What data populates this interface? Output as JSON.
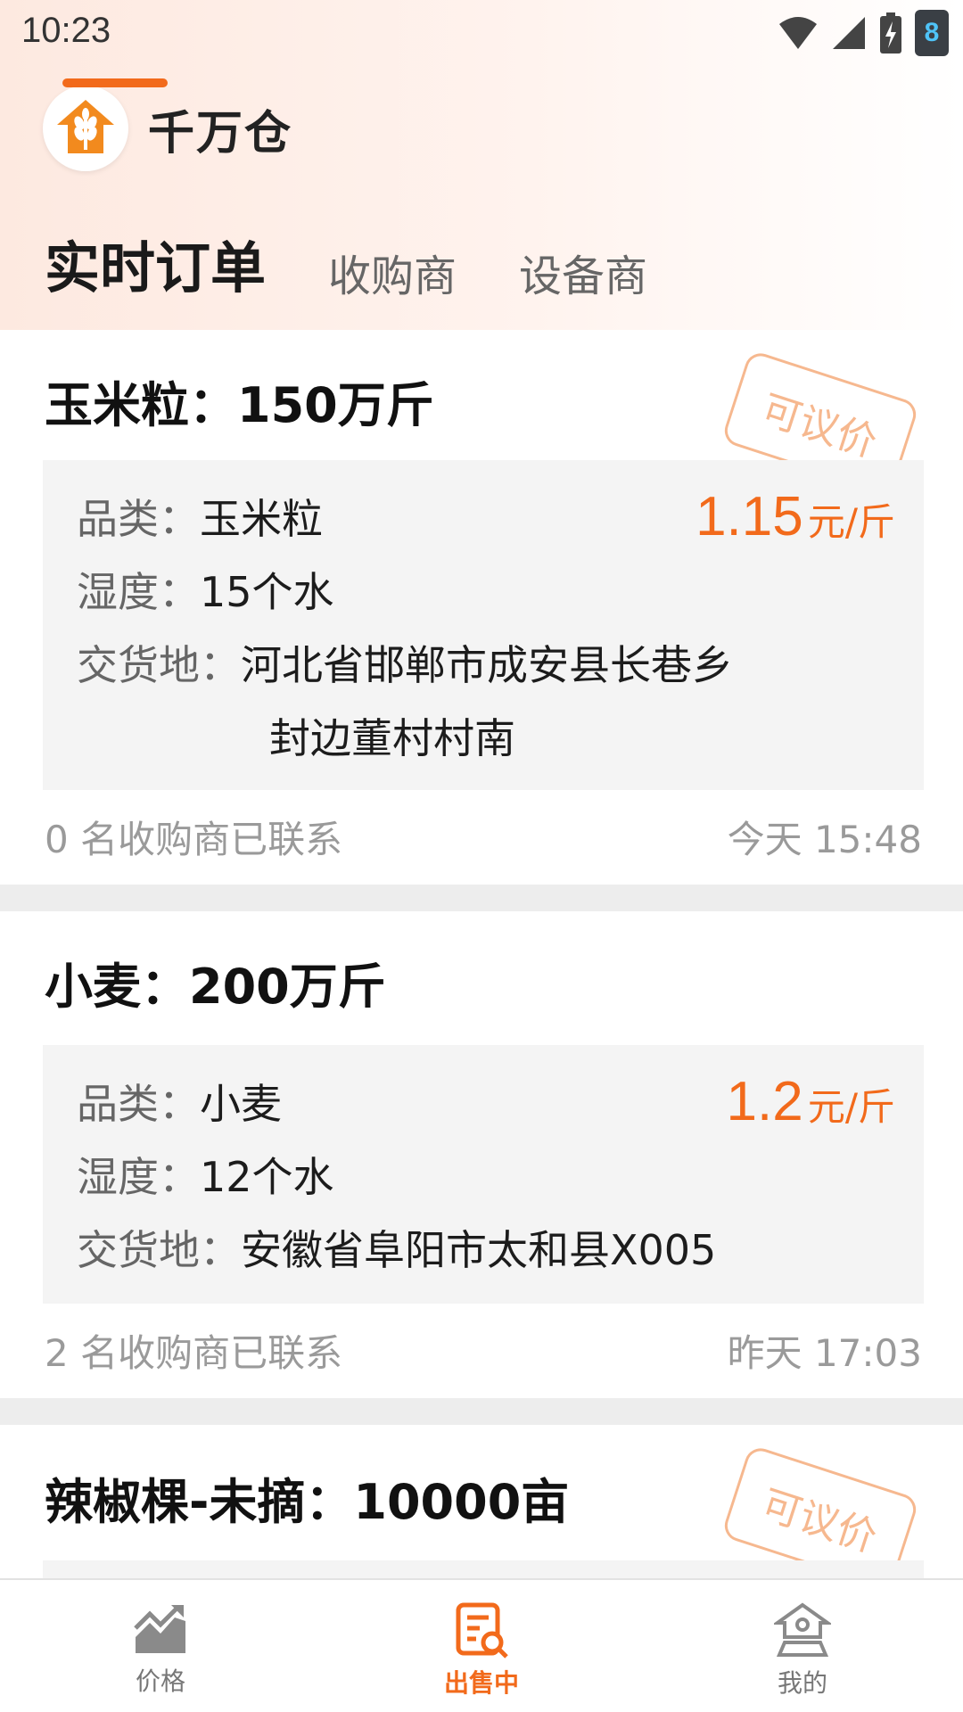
{
  "status_bar": {
    "time": "10:23",
    "battery_level": "8"
  },
  "brand": {
    "name": "千万仓"
  },
  "tabs": [
    {
      "label": "实时订单",
      "active": true
    },
    {
      "label": "收购商",
      "active": false
    },
    {
      "label": "设备商",
      "active": false
    }
  ],
  "orders": [
    {
      "title": "玉米粒：150万斤",
      "stamp": "可议价",
      "category_label": "品类：",
      "category": "玉米粒",
      "moisture_label": "湿度：",
      "moisture": "15个水",
      "location_label": "交货地：",
      "location_line1": "河北省邯郸市成安县长巷乡",
      "location_line2": "封边董村村南",
      "price": "1.15",
      "price_unit": "元/斤",
      "contacts": "0 名收购商已联系",
      "time": "今天 15:48"
    },
    {
      "title": "小麦：200万斤",
      "category_label": "品类：",
      "category": "小麦",
      "moisture_label": "湿度：",
      "moisture": "12个水",
      "location_label": "交货地：",
      "location_line1": "安徽省阜阳市太和县X005",
      "price": "1.2",
      "price_unit": "元/斤",
      "contacts": "2 名收购商已联系",
      "time": "昨天 17:03"
    },
    {
      "title": "辣椒棵-未摘：10000亩",
      "stamp": "可议价"
    }
  ],
  "bottom_nav": [
    {
      "label": "价格",
      "icon": "chart-trend-icon",
      "active": false
    },
    {
      "label": "出售中",
      "icon": "order-search-icon",
      "active": true
    },
    {
      "label": "我的",
      "icon": "warehouse-user-icon",
      "active": false
    }
  ],
  "colors": {
    "accent": "#f26a1b",
    "stamp": "#f6b88f",
    "muted": "#9a9a9a"
  }
}
